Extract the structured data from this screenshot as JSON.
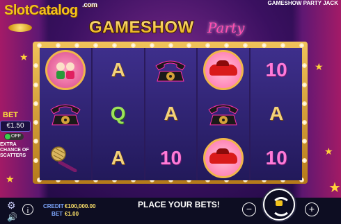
{
  "watermark": {
    "text": "SlotCatalog",
    "com": ".com"
  },
  "header": {
    "title_right": "GAMESHOW PARTY JACK"
  },
  "logo": {
    "main": "GAMESHOW",
    "script": "Party"
  },
  "bet_panel": {
    "title": "BET",
    "value": "€1.50",
    "toggle_label": "OFF",
    "extra_text": "EXTRA CHANCE OF SCATTERS"
  },
  "reels": [
    [
      {
        "type": "portrait",
        "name": "hosts-symbol"
      },
      {
        "type": "phone",
        "name": "phone-symbol"
      },
      {
        "type": "mic",
        "name": "microphone-symbol"
      }
    ],
    [
      {
        "type": "letter",
        "text": "A"
      },
      {
        "type": "letter",
        "text": "Q",
        "color": "green"
      },
      {
        "type": "letter",
        "text": "A"
      }
    ],
    [
      {
        "type": "phone",
        "name": "phone-symbol"
      },
      {
        "type": "letter",
        "text": "A"
      },
      {
        "type": "letter",
        "text": "10",
        "color": "ten"
      }
    ],
    [
      {
        "type": "car",
        "name": "car-symbol"
      },
      {
        "type": "phone",
        "name": "phone-symbol"
      },
      {
        "type": "car",
        "name": "car-symbol"
      }
    ],
    [
      {
        "type": "letter",
        "text": "10",
        "color": "ten"
      },
      {
        "type": "letter",
        "text": "A"
      },
      {
        "type": "letter",
        "text": "10",
        "color": "ten"
      }
    ]
  ],
  "bottom": {
    "credit_label": "CREDIT",
    "credit_value": "€100,000.00",
    "bet_label": "BET",
    "bet_value": "€1.00",
    "message": "PLACE YOUR BETS!",
    "minus": "−",
    "plus": "+",
    "info": "i"
  },
  "colors": {
    "accent": "#f2c21b",
    "frame": "#e0a73a",
    "reel_bg": "#2e2370"
  }
}
